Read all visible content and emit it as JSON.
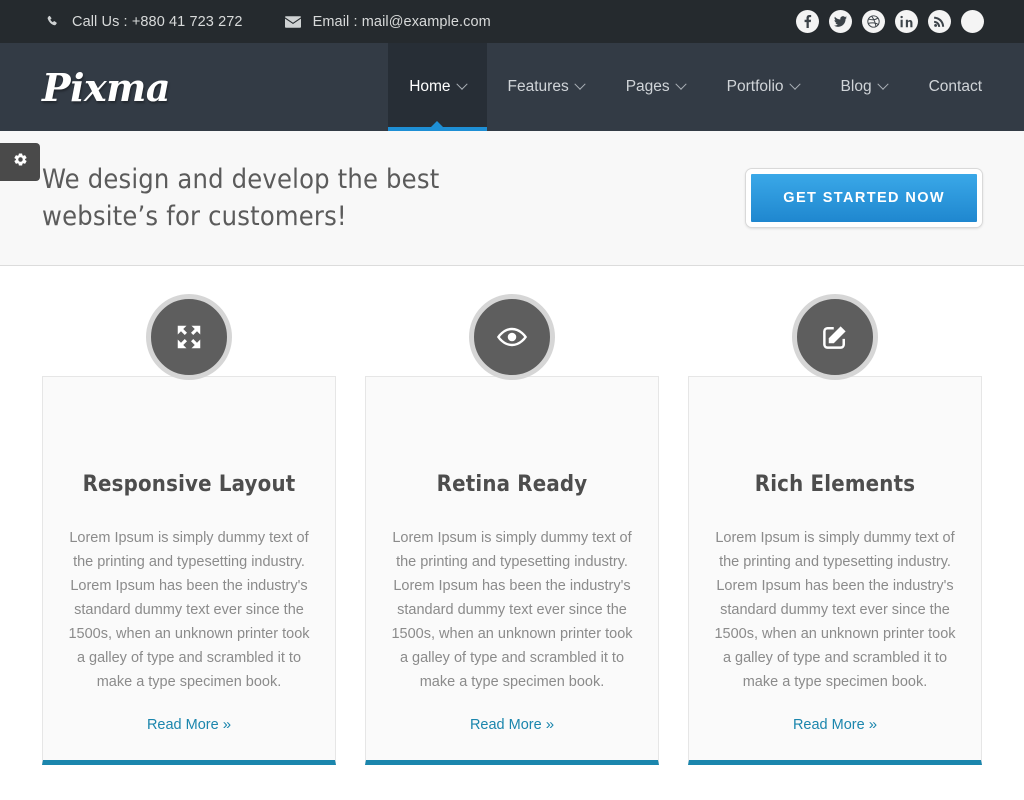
{
  "topbar": {
    "phone": {
      "icon": "phone-icon",
      "label": "Call Us : +880 41 723 272"
    },
    "email": {
      "icon": "envelope-icon",
      "label": "Email : mail@example.com"
    },
    "socials": [
      {
        "name": "facebook-icon"
      },
      {
        "name": "twitter-icon"
      },
      {
        "name": "dribbble-icon"
      },
      {
        "name": "linkedin-icon"
      },
      {
        "name": "rss-icon"
      },
      {
        "name": "blank-social-icon"
      }
    ],
    "background": "#252a2e"
  },
  "header": {
    "logo": "Pixma",
    "background": "#333b45",
    "active_color": "#1e8fd5",
    "nav": [
      {
        "label": "Home",
        "caret": true,
        "active": true
      },
      {
        "label": "Features",
        "caret": true,
        "active": false
      },
      {
        "label": "Pages",
        "caret": true,
        "active": false
      },
      {
        "label": "Portfolio",
        "caret": true,
        "active": false
      },
      {
        "label": "Blog",
        "caret": true,
        "active": false
      },
      {
        "label": "Contact",
        "caret": false,
        "active": false
      }
    ]
  },
  "hero": {
    "settings_icon": "gear-icon",
    "title": "We design and develop the best website’s for customers!",
    "cta_label": "GET STARTED NOW",
    "cta_color": "#2592d8",
    "background": "#f8f8f8"
  },
  "features": {
    "accent_color": "#1b86ad",
    "cards": [
      {
        "icon": "arrows-expand-icon",
        "title": "Responsive Layout",
        "text": "Lorem Ipsum is simply dummy text of the printing and typesetting industry. Lorem Ipsum has been the industry's standard dummy text ever since the 1500s, when an unknown printer took a galley of type and scrambled it to make a type specimen book.",
        "link": "Read More",
        "link_chevron": "»"
      },
      {
        "icon": "eye-icon",
        "title": "Retina Ready",
        "text": "Lorem Ipsum is simply dummy text of the printing and typesetting industry. Lorem Ipsum has been the industry's standard dummy text ever since the 1500s, when an unknown printer took a galley of type and scrambled it to make a type specimen book.",
        "link": "Read More",
        "link_chevron": "»"
      },
      {
        "icon": "pencil-square-icon",
        "title": "Rich Elements",
        "text": "Lorem Ipsum is simply dummy text of the printing and typesetting industry. Lorem Ipsum has been the industry's standard dummy text ever since the 1500s, when an unknown printer took a galley of type and scrambled it to make a type specimen book.",
        "link": "Read More",
        "link_chevron": "»"
      }
    ]
  }
}
